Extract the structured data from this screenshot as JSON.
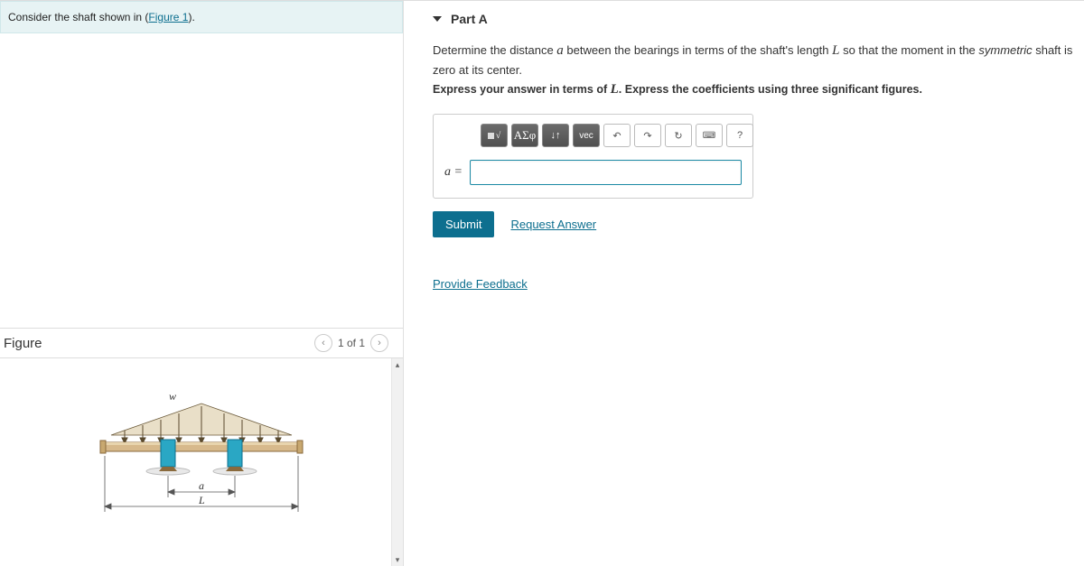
{
  "intro": {
    "pre": "Consider the shaft shown in (",
    "link": "Figure 1",
    "post": ")."
  },
  "figure": {
    "heading": "Figure",
    "pager": "1 of 1",
    "labels": {
      "w": "w",
      "a": "a",
      "L": "L"
    }
  },
  "part": {
    "title": "Part A",
    "prompt_pre": "Determine the distance ",
    "var_a": "a",
    "prompt_mid": " between the bearings in terms of the shaft's length ",
    "var_L": "L",
    "prompt_post": " so that the moment in the ",
    "ital_word": "symmetric",
    "prompt_end": " shaft is zero at its center.",
    "hint_pre": "Express your answer in terms of ",
    "hint_L": "L",
    "hint_post": ". Express the coefficients using three significant figures."
  },
  "toolbar": {
    "templates": "x√",
    "greek": "ΑΣφ",
    "subsup": "↓↑",
    "vec": "vec",
    "undo": "↶",
    "redo": "↷",
    "reset": "↻",
    "keyboard": "⌨",
    "help": "?"
  },
  "answer": {
    "label": "a ="
  },
  "actions": {
    "submit": "Submit",
    "request": "Request Answer",
    "feedback": "Provide Feedback"
  }
}
